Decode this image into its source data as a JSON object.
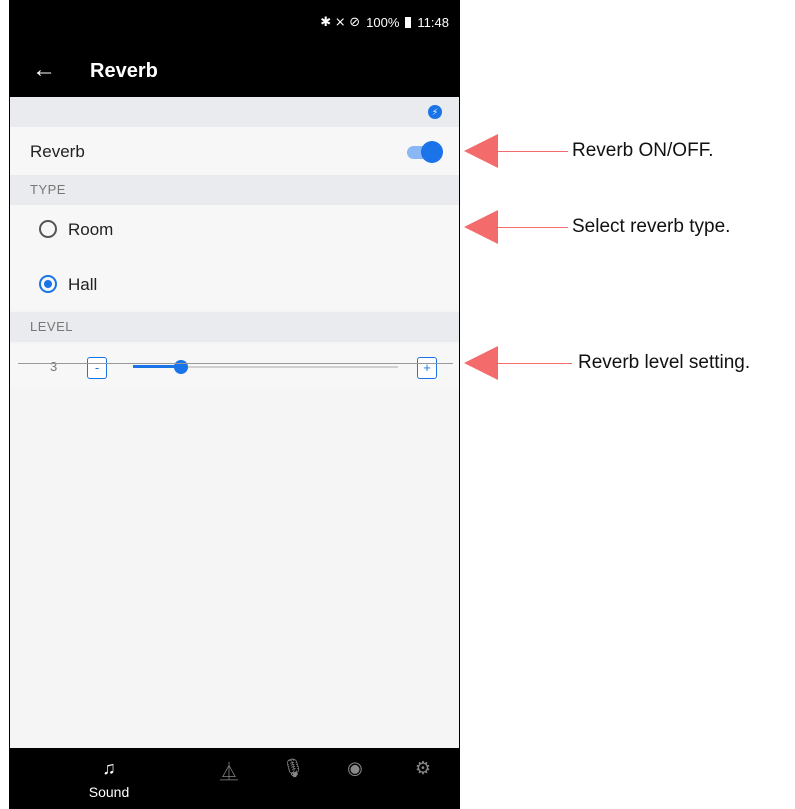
{
  "status_bar": {
    "icons": "✱ ⨯ ⊘",
    "battery": "100%",
    "time": "11:48"
  },
  "app_bar": {
    "back_icon": "←",
    "title": "Reverb"
  },
  "reverb_row": {
    "label": "Reverb",
    "switch_on": true
  },
  "type_section": {
    "header": "TYPE",
    "options": [
      {
        "label": "Room",
        "selected": false
      },
      {
        "label": "Hall",
        "selected": true
      }
    ]
  },
  "level_section": {
    "header": "LEVEL",
    "value": "3",
    "minus_label": "-",
    "plus_label": "+",
    "slider_fraction": 0.18
  },
  "bottom_nav": [
    {
      "label": "Sound",
      "icon": "music-note-icon",
      "glyph": "♫",
      "active": true
    },
    {
      "label": "",
      "icon": "metronome-icon",
      "glyph": "⏅",
      "active": false
    },
    {
      "label": "",
      "icon": "microphone-icon",
      "glyph": "🎙",
      "active": false
    },
    {
      "label": "",
      "icon": "speaker-icon",
      "glyph": "◉",
      "active": false
    },
    {
      "label": "",
      "icon": "gear-icon",
      "glyph": "⚙",
      "active": false
    }
  ],
  "callouts": [
    {
      "text": "Reverb ON/OFF."
    },
    {
      "text": "Select reverb type."
    },
    {
      "text": "Reverb level setting."
    }
  ],
  "colors": {
    "accent": "#1a73e8",
    "callout": "#f36b6b",
    "bar": "#000000"
  }
}
